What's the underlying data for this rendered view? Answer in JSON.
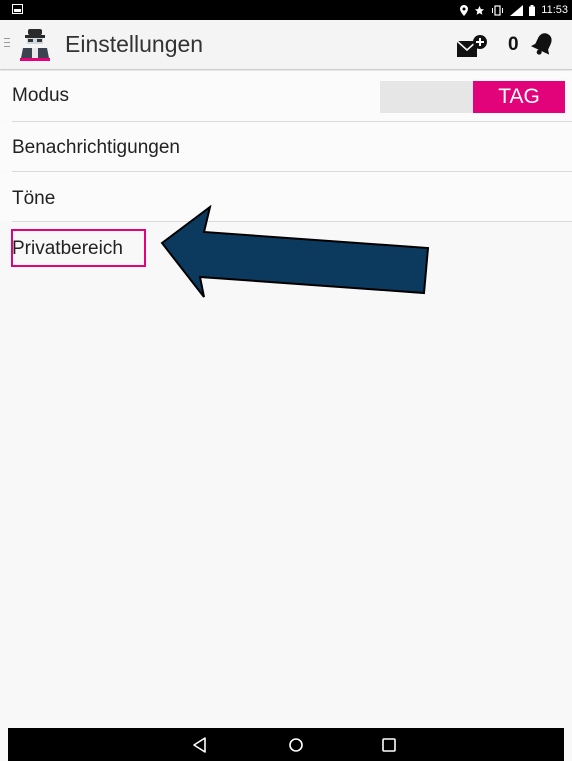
{
  "statusbar": {
    "time": "11:53",
    "icons": [
      "location-icon",
      "star-icon",
      "vibrate-icon",
      "signal-icon",
      "battery-icon"
    ]
  },
  "appbar": {
    "title": "Einstellungen",
    "notification_count": "0",
    "icons": [
      "menu-icon",
      "app-logo-icon",
      "mail-add-icon",
      "bell-icon"
    ]
  },
  "settings": {
    "rows": [
      {
        "label": "Modus"
      },
      {
        "label": "Benachrichtigungen"
      },
      {
        "label": "Töne"
      },
      {
        "label": "Privatbereich"
      }
    ],
    "mode_toggle": {
      "active_label": "TAG"
    }
  },
  "navbar": {
    "icons": [
      "back-icon",
      "home-icon",
      "recents-icon"
    ]
  },
  "colors": {
    "accent": "#e2037a",
    "arrow_fill": "#0b3a5e",
    "statusbar_bg": "#000000"
  }
}
